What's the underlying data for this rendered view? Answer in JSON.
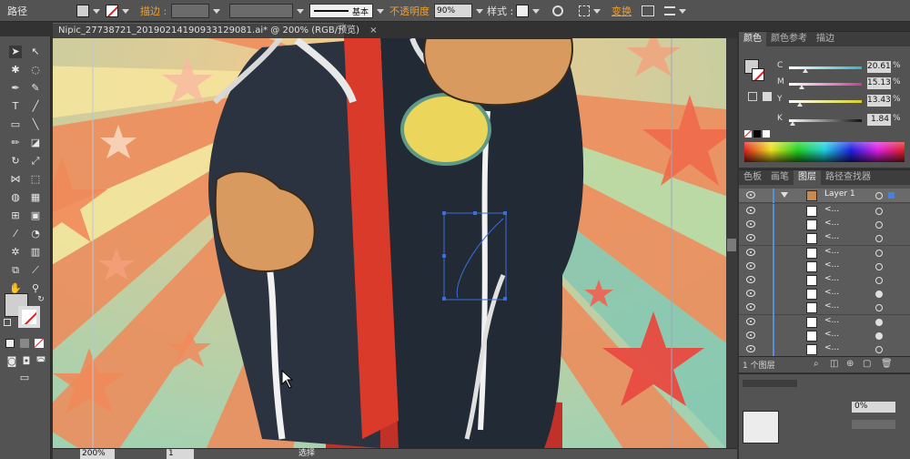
{
  "control_bar": {
    "object_type": "路径",
    "stroke_label": "描边 :",
    "opacity_label": "不透明度 :",
    "opacity_value": "90%",
    "style_label": "样式 :",
    "brush_value": "基本",
    "transform_label": "变换"
  },
  "document": {
    "tab_title": "Nipic_27738721_20190214190933129081.ai* @ 200% (RGB/预览)"
  },
  "status_bar": {
    "zoom": "200%",
    "artboard": "1",
    "tool_name": "选择"
  },
  "color_panel": {
    "tabs": [
      "颜色",
      "颜色参考",
      "描边"
    ],
    "active_tab": "颜色",
    "sliders": [
      {
        "label": "C",
        "value": "20.61",
        "color": "#2fb5c9"
      },
      {
        "label": "M",
        "value": "15.13",
        "color": "#c93a9b"
      },
      {
        "label": "Y",
        "value": "13.43",
        "color": "#d9d02a"
      },
      {
        "label": "K",
        "value": "1.84",
        "color": "#e0e0e0"
      }
    ],
    "pct": "%"
  },
  "layers_panel": {
    "tabs": [
      "色板",
      "画笔",
      "图层",
      "路径查找器"
    ],
    "active_tab": "图层",
    "layer_name": "Layer 1",
    "sublayer_name": "<...",
    "footer_count": "1 个图层"
  },
  "lower_panel": {
    "opacity_value": "0%"
  },
  "colors": {
    "chrome": "#535353",
    "accent_orange": "#f0a030",
    "selection_blue": "#3a6fd8"
  }
}
